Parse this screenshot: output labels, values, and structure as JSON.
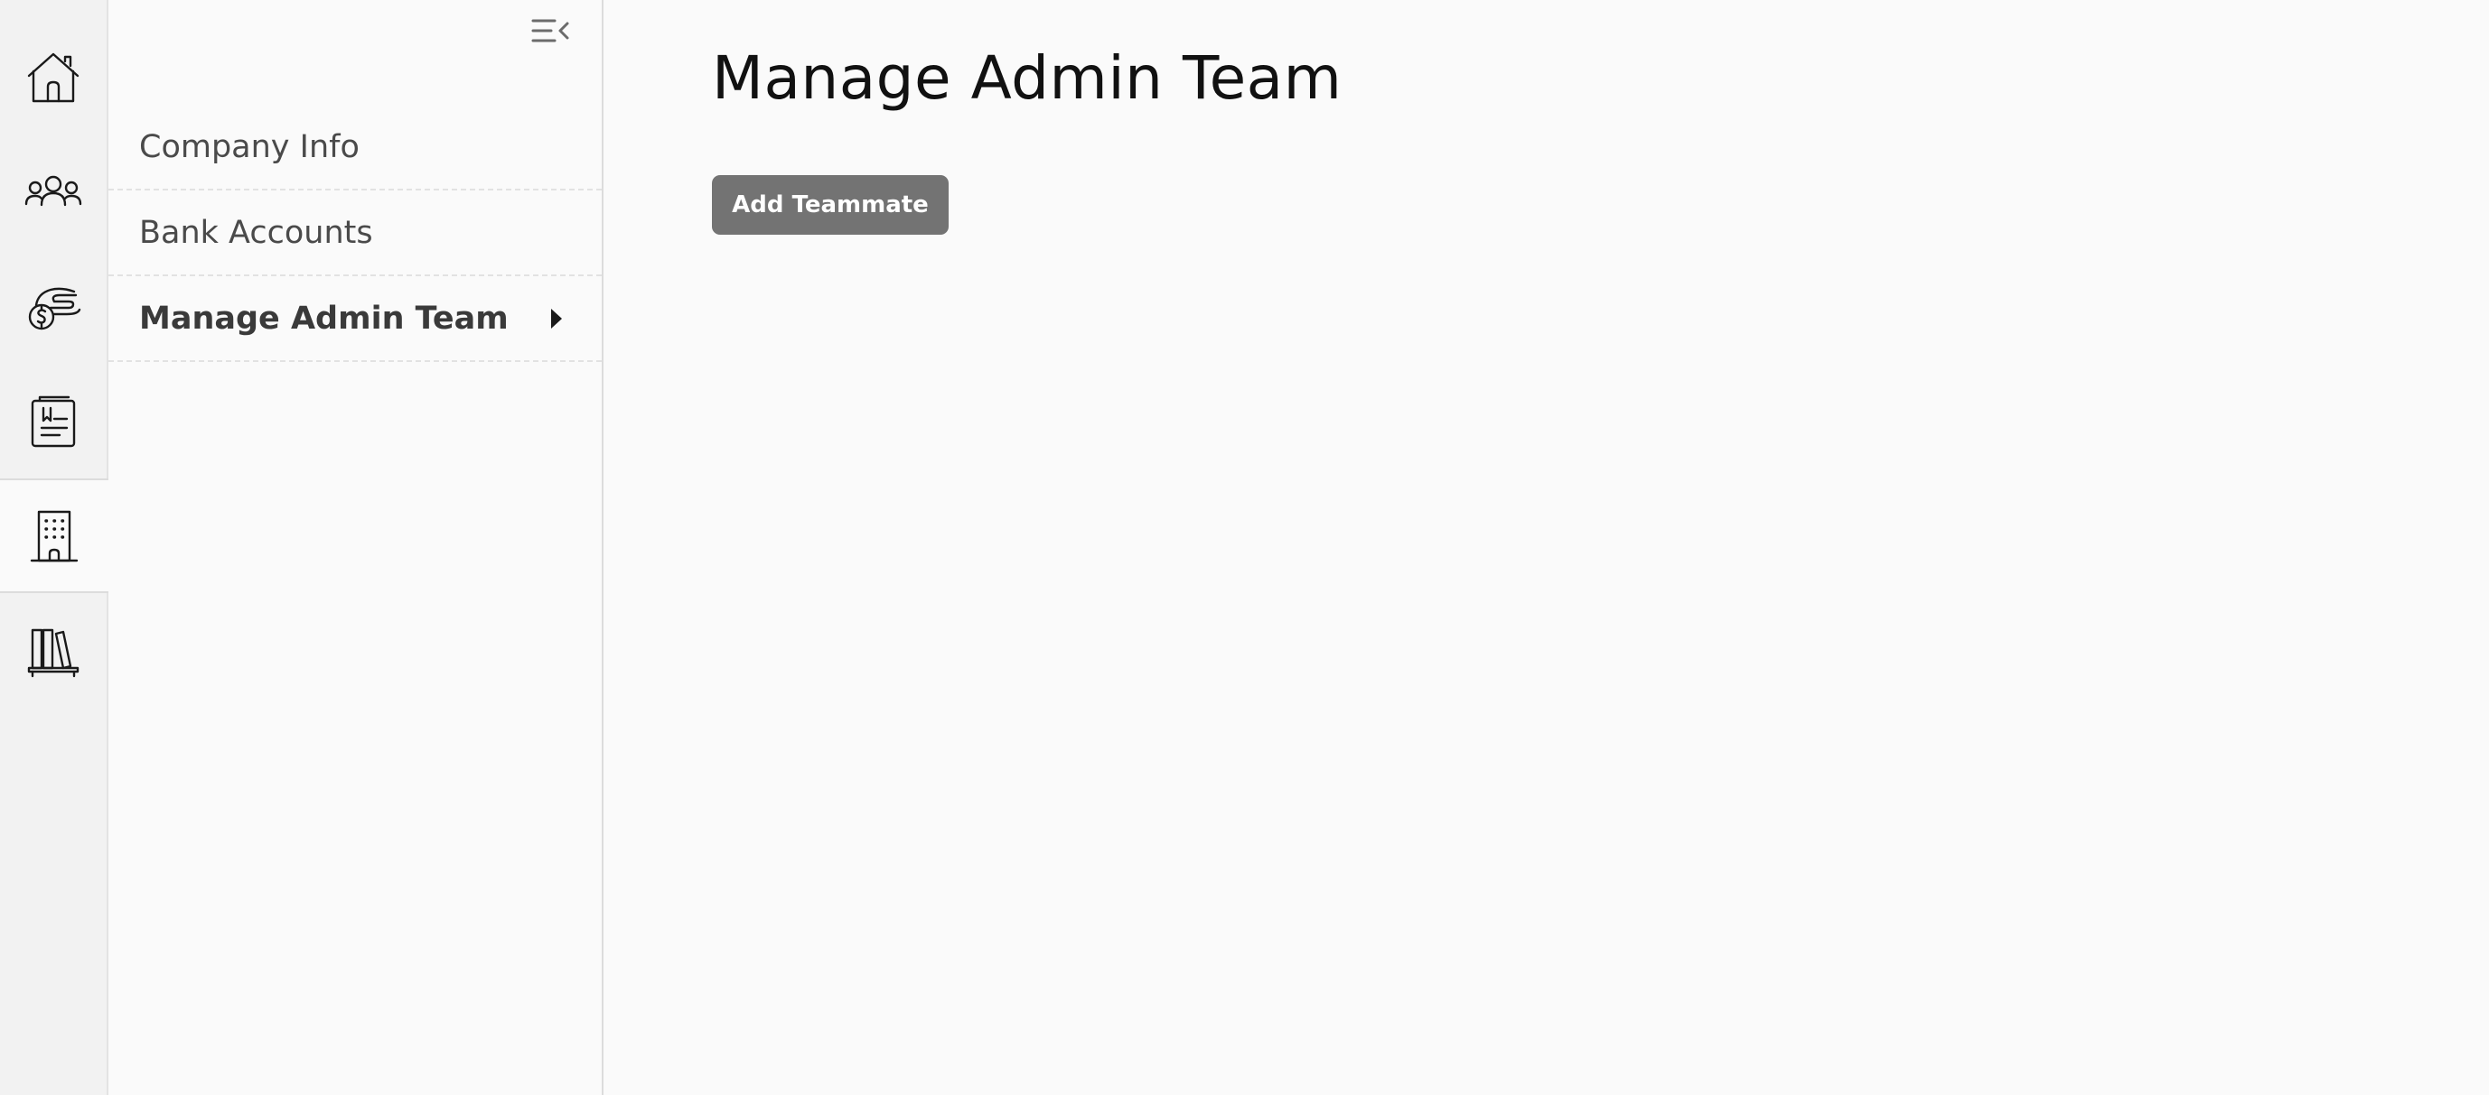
{
  "rail": {
    "items": [
      {
        "icon": "home-icon"
      },
      {
        "icon": "people-icon"
      },
      {
        "icon": "hand-money-icon"
      },
      {
        "icon": "document-icon"
      },
      {
        "icon": "building-icon",
        "active": true
      },
      {
        "icon": "library-icon"
      }
    ]
  },
  "subnav": {
    "collapse_icon": "collapse-menu-icon",
    "items": [
      {
        "label": "Company Info"
      },
      {
        "label": "Bank Accounts"
      },
      {
        "label": "Manage Admin Team",
        "active": true
      }
    ]
  },
  "main": {
    "title": "Manage Admin Team",
    "add_button_label": "Add Teammate",
    "add_button_color": "#737373"
  },
  "colors": {
    "background": "#fafafa",
    "rail_background": "#f2f2f2",
    "text": "#111111"
  }
}
